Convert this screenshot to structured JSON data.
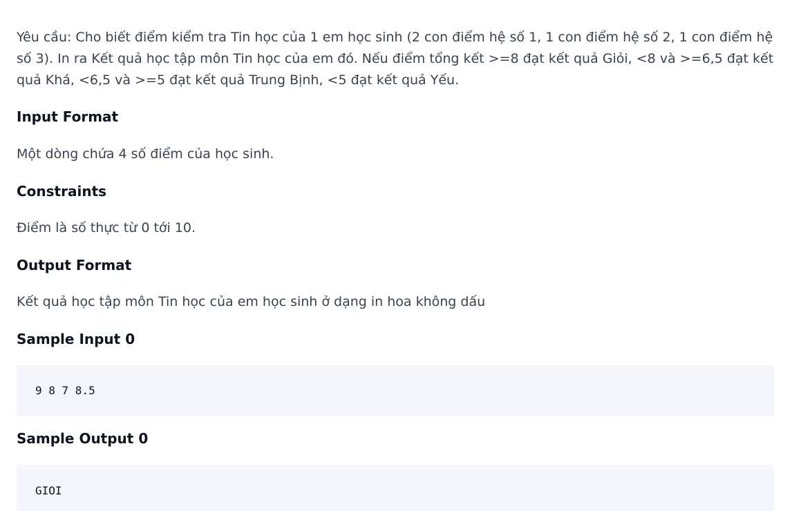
{
  "statement": "Yêu cầu: Cho biết điểm kiểm tra Tin học của 1 em học sinh (2 con điểm hệ số 1, 1 con điểm hệ số 2, 1 con điểm hệ số 3). In ra Kết quả học tập môn Tin học của em đó. Nếu điểm tổng kết >=8 đạt kết quả Giỏi, <8 và >=6,5 đạt kết quả Khá, <6,5 và >=5 đạt kết quả Trung Bịnh, <5 đạt kết quả Yếu.",
  "input_format": {
    "heading": "Input Format",
    "text": "Một dòng chứa 4 số điểm của học sinh."
  },
  "constraints": {
    "heading": "Constraints",
    "text": "Điểm là số thực từ 0 tới 10."
  },
  "output_format": {
    "heading": "Output Format",
    "text": "Kết quả học tập môn Tin học của em học sinh ở dạng in hoa không dấu"
  },
  "sample_input": {
    "heading": "Sample Input 0",
    "code": "9 8 7 8.5"
  },
  "sample_output": {
    "heading": "Sample Output 0",
    "code": "GIOI"
  }
}
